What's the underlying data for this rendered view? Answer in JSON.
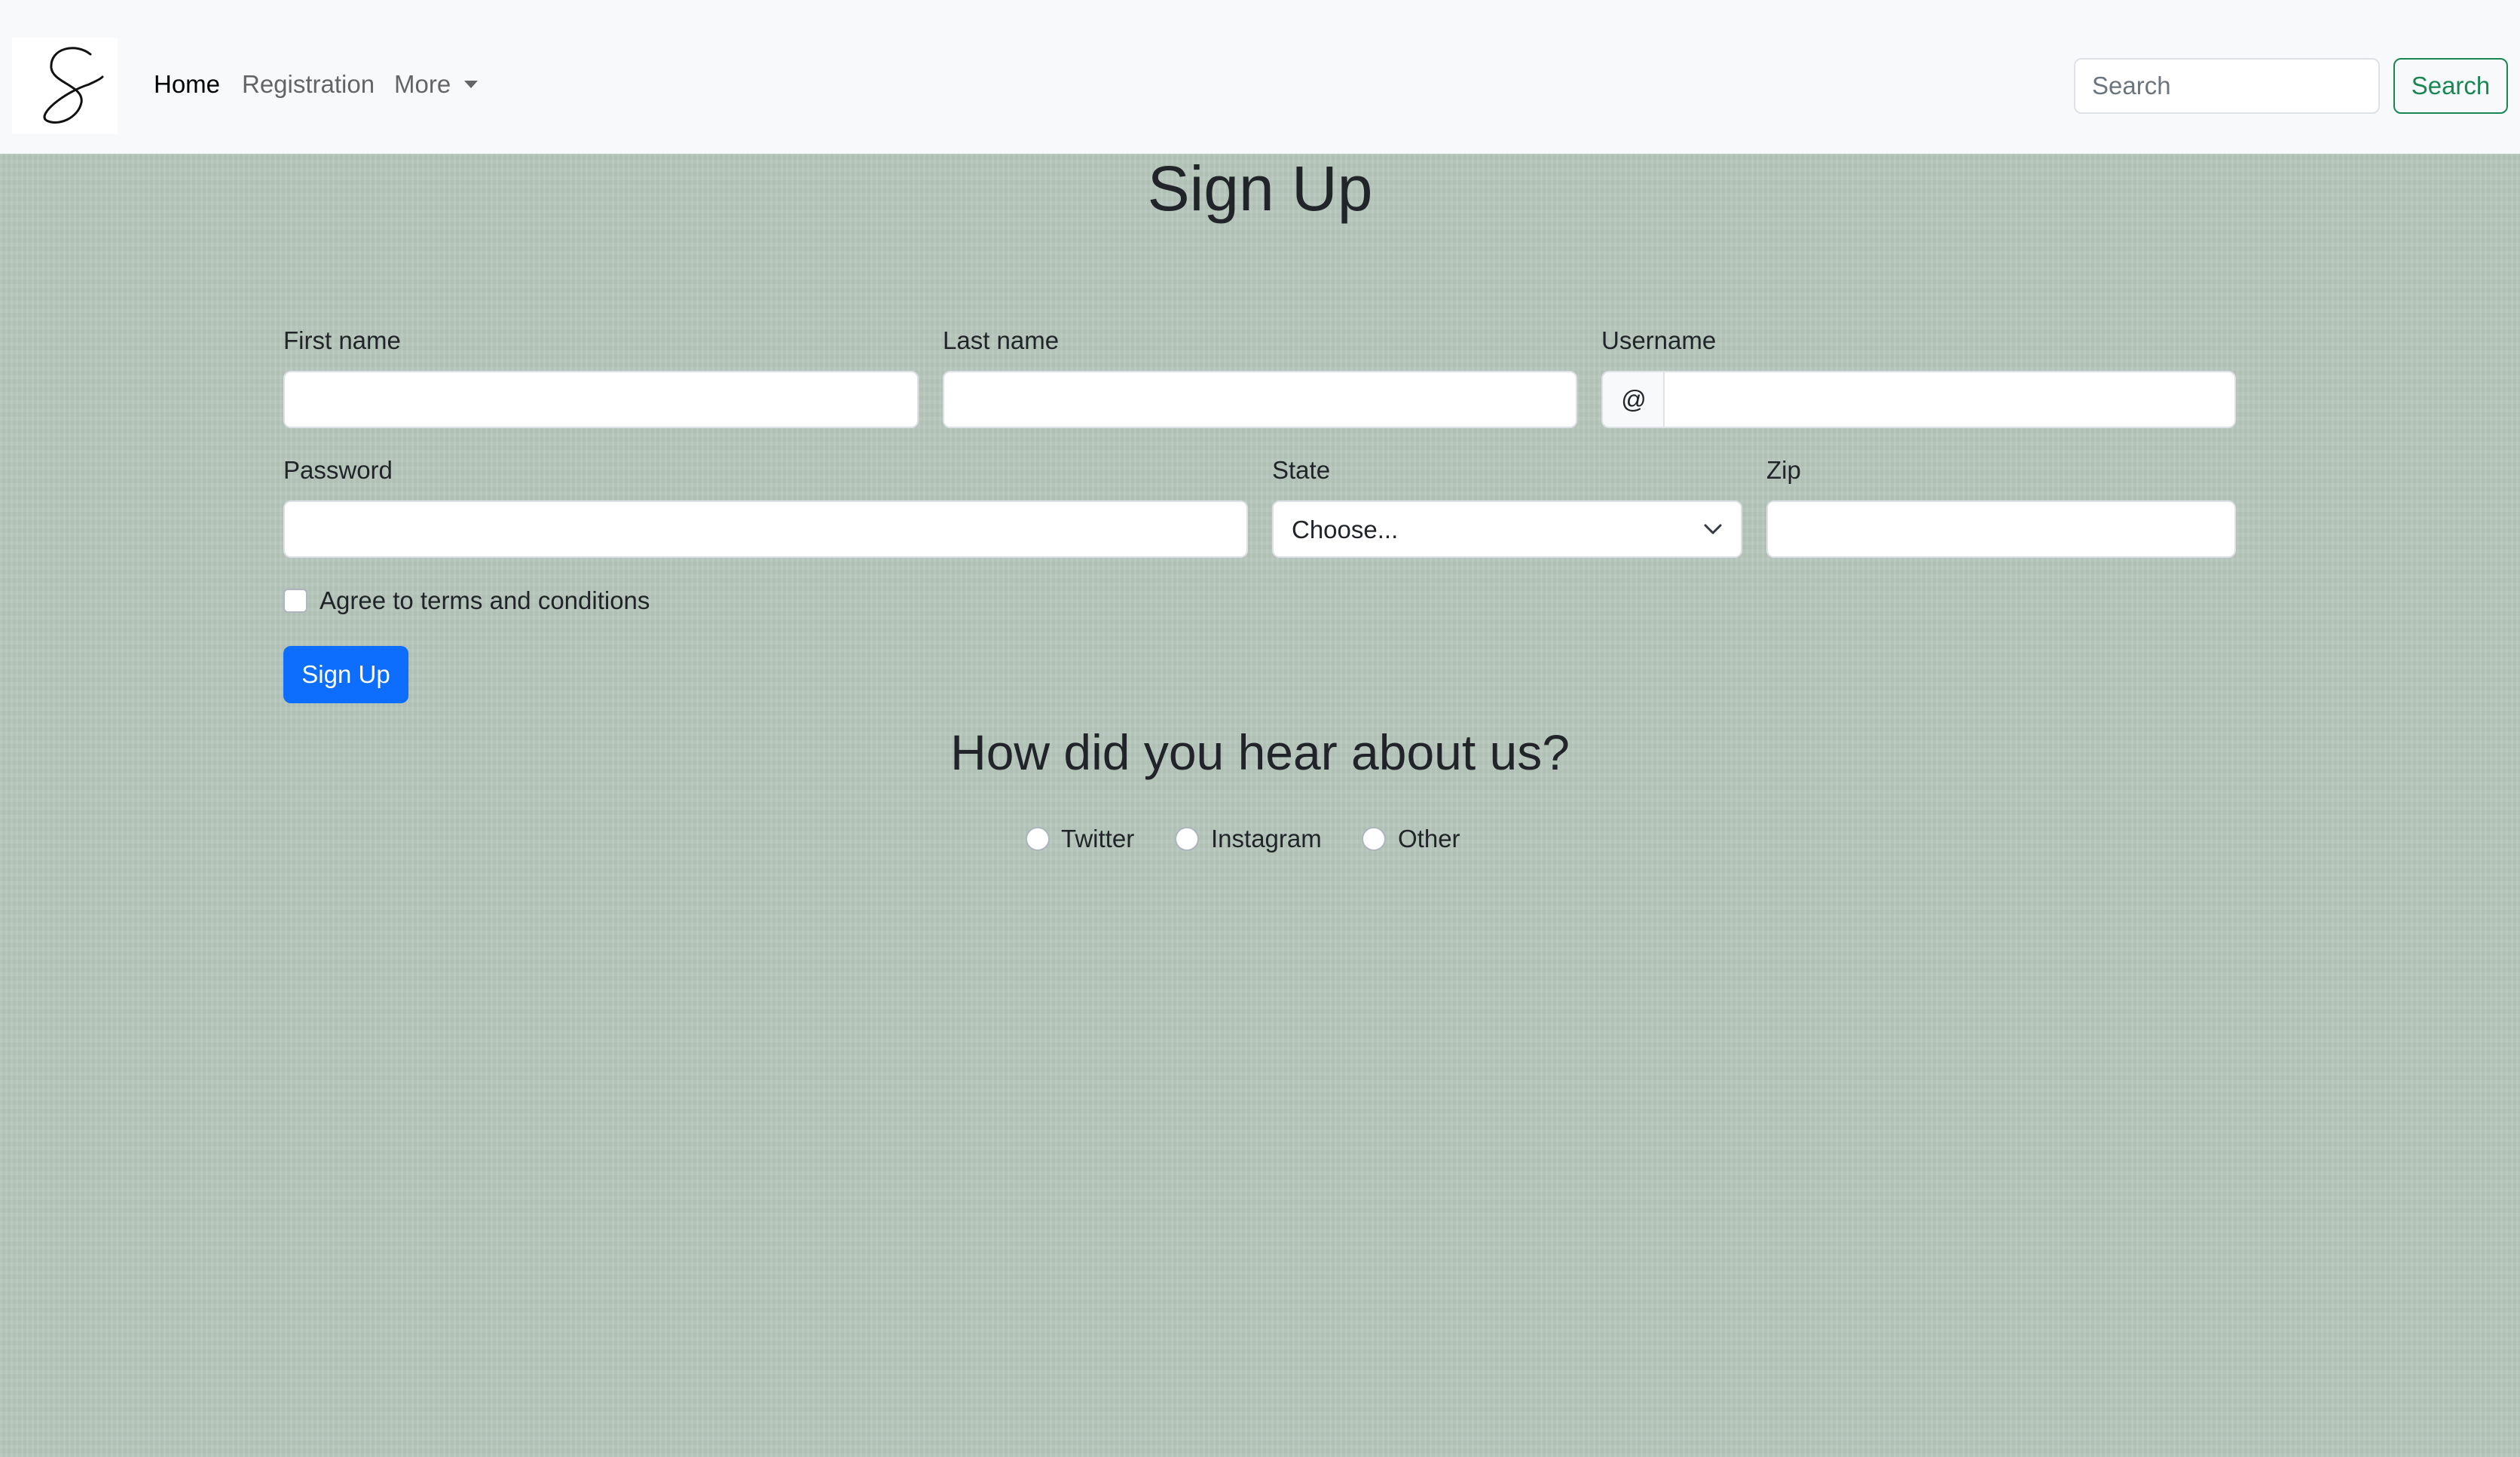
{
  "navbar": {
    "logo_icon": "signature-s-logo-icon",
    "links": {
      "home": "Home",
      "registration": "Registration",
      "more": "More"
    },
    "search_placeholder": "Search",
    "search_button": "Search",
    "search_button_color": "#198754"
  },
  "page": {
    "title": "Sign Up",
    "background_color": "#b6c7bc"
  },
  "form": {
    "first_name": {
      "label": "First name",
      "value": ""
    },
    "last_name": {
      "label": "Last name",
      "value": ""
    },
    "username": {
      "label": "Username",
      "prefix": "@",
      "value": ""
    },
    "password": {
      "label": "Password",
      "value": ""
    },
    "state": {
      "label": "State",
      "selected": "Choose..."
    },
    "zip": {
      "label": "Zip",
      "value": ""
    },
    "terms": {
      "label": "Agree to terms and conditions",
      "checked": false
    },
    "submit_label": "Sign Up",
    "submit_color": "#0d6efd"
  },
  "survey": {
    "title": "How did you hear about us?",
    "options": [
      "Twitter",
      "Instagram",
      "Other"
    ]
  }
}
